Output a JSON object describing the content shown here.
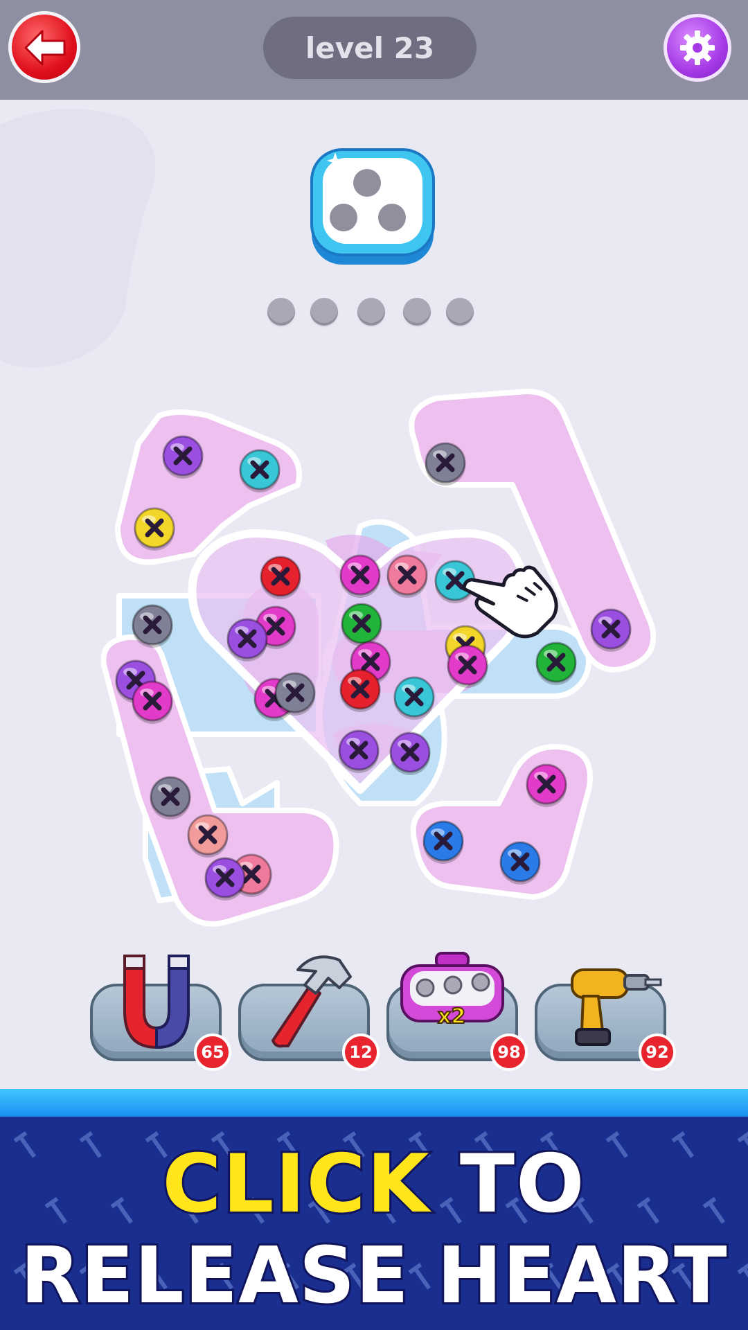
{
  "header": {
    "back_icon": "back-arrow-icon",
    "level_label": "level 23",
    "settings_icon": "gear-icon"
  },
  "target": {
    "icon": "three-hole-screw-box-icon",
    "progress_total": 5,
    "progress_filled": 0
  },
  "board": {
    "screw_colors": {
      "purple": "#9b4fe0",
      "cyan": "#39c6d6",
      "yellow": "#f2d62a",
      "grey": "#7f7f96",
      "red": "#e5212e",
      "green": "#22b43a",
      "magenta": "#e33bc9",
      "pink": "#ef7a9b",
      "salmon": "#f29b9b",
      "blue": "#2a7be8"
    },
    "hint": "tap-hand-pointer-icon"
  },
  "tools": [
    {
      "name": "magnet",
      "icon": "magnet-icon",
      "count": "65"
    },
    {
      "name": "hammer",
      "icon": "hammer-icon",
      "count": "12"
    },
    {
      "name": "extra-box",
      "icon": "screw-box-x2-icon",
      "label": "x2",
      "count": "98"
    },
    {
      "name": "drill",
      "icon": "drill-icon",
      "count": "92"
    }
  ],
  "banner": {
    "word_click": "CLICK",
    "word_to": " TO",
    "line2": "RELEASE HEART"
  }
}
